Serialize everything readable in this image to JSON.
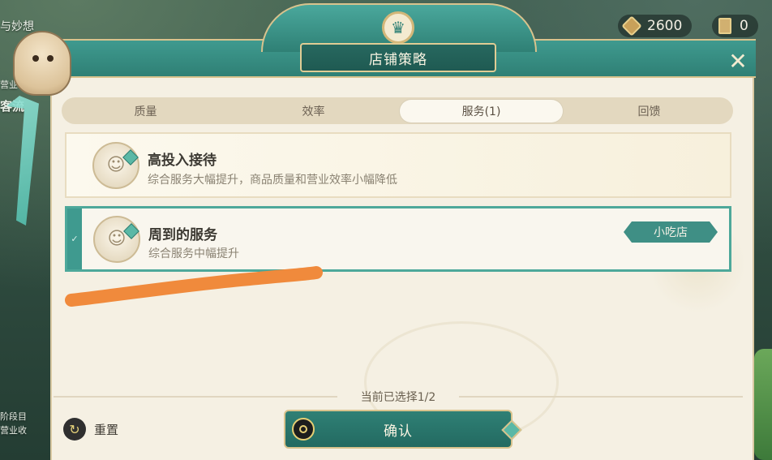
{
  "background": {
    "left_texts": [
      "与妙想",
      "营业",
      "客流",
      "阶段目",
      "营业收"
    ],
    "currencies": [
      {
        "icon": "mora-gem-icon",
        "value": "2600"
      },
      {
        "icon": "ticket-card-icon",
        "value": "0"
      }
    ]
  },
  "dialog": {
    "title": "店铺策略",
    "close_icon": "close-x-icon",
    "tabs": [
      {
        "label": "质量",
        "active": false
      },
      {
        "label": "效率",
        "active": false
      },
      {
        "label": "服务(1)",
        "active": true
      },
      {
        "label": "回馈",
        "active": false
      }
    ],
    "options": [
      {
        "title": "高投入接待",
        "description": "综合服务大幅提升，商品质量和营业效率小幅降低",
        "selected": false,
        "icon": "strategy-portrait-icon"
      },
      {
        "title": "周到的服务",
        "description": "综合服务中幅提升",
        "selected": true,
        "icon": "strategy-portrait-icon",
        "tag": "小吃店"
      }
    ],
    "footer": {
      "selection_status": "当前已选择1/2",
      "reset_label": "重置",
      "confirm_label": "确认"
    }
  },
  "colors": {
    "teal_primary": "#2f8075",
    "panel_bg": "#f5f0e3",
    "gold_trim": "#d9c38d",
    "selected_border": "#4da89a",
    "scribble": "#f08a3c"
  }
}
